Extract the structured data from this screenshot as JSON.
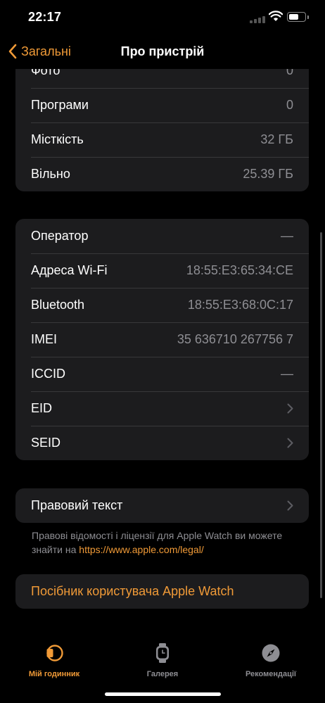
{
  "status_bar": {
    "time": "22:17"
  },
  "nav": {
    "back_label": "Загальні",
    "title": "Про пристрій"
  },
  "storage": [
    {
      "label": "Фото",
      "value": "0"
    },
    {
      "label": "Програми",
      "value": "0"
    },
    {
      "label": "Місткість",
      "value": "32 ГБ"
    },
    {
      "label": "Вільно",
      "value": "25.39 ГБ"
    }
  ],
  "network": {
    "operator": {
      "label": "Оператор",
      "value": "—"
    },
    "wifi": {
      "label": "Адреса Wi-Fi",
      "value": "18:55:E3:65:34:CE"
    },
    "bluetooth": {
      "label": "Bluetooth",
      "value": "18:55:E3:68:0C:17"
    },
    "imei": {
      "label": "IMEI",
      "value": "35 636710 267756 7"
    },
    "iccid": {
      "label": "ICCID",
      "value": "—"
    },
    "eid": {
      "label": "EID"
    },
    "seid": {
      "label": "SEID"
    }
  },
  "legal": {
    "label": "Правовий текст",
    "footnote": "Правові відомості і ліцензії для Apple Watch ви можете знайти на",
    "link": "https://www.apple.com/legal/"
  },
  "guide_label": "Посібник користувача Apple Watch",
  "tabs": [
    {
      "label": "Мій годинник",
      "icon": "watch-face-icon",
      "active": true
    },
    {
      "label": "Галерея",
      "icon": "watch-gallery-icon",
      "active": false
    },
    {
      "label": "Рекомендації",
      "icon": "compass-icon",
      "active": false
    }
  ],
  "colors": {
    "accent": "#f09a37",
    "background": "#000000",
    "cell": "#1c1c1e",
    "secondary_text": "#8e8e93"
  }
}
